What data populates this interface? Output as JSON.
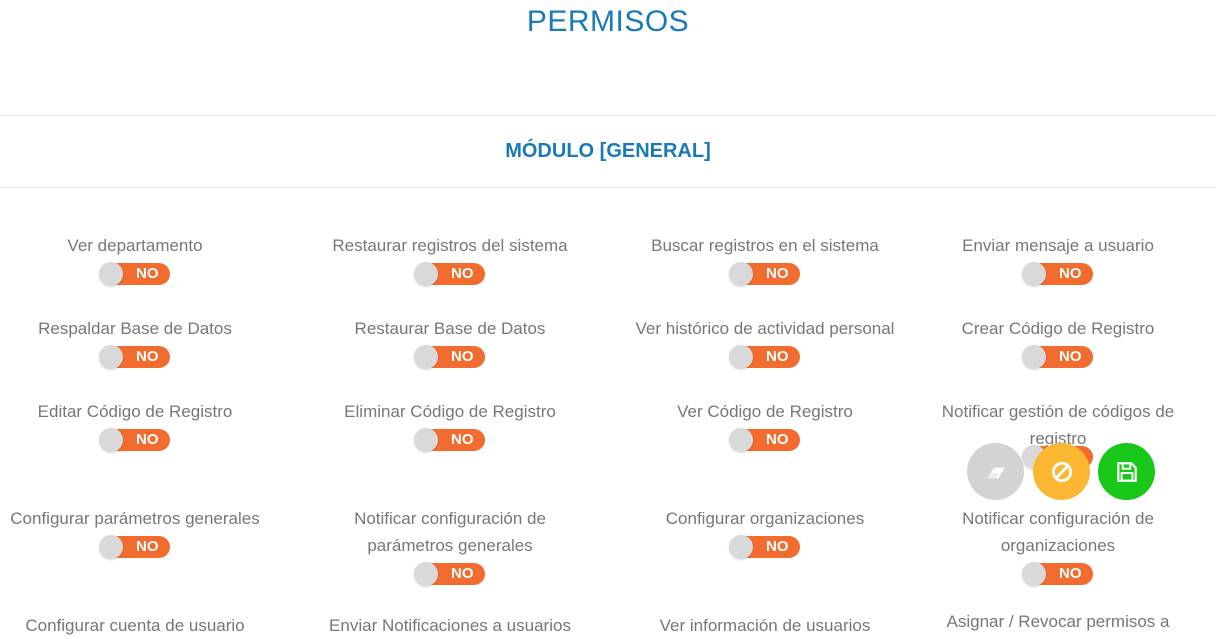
{
  "header": {
    "title": "PERMISOS"
  },
  "module": {
    "title": "MÓDULO [GENERAL]"
  },
  "toggle_state": "NO",
  "colors": {
    "accent": "#1a7ab8",
    "toggle_off": "#f26c2f",
    "clear_button": "#d3d3d3",
    "cancel_button": "#fbb731",
    "save_button": "#19c719"
  },
  "columns": [
    [
      "Ver departamento",
      "Respaldar Base de Datos",
      "Editar Código de Registro",
      "Configurar parámetros generales",
      "Configurar cuenta de usuario"
    ],
    [
      "Restaurar registros del sistema",
      "Restaurar Base de Datos",
      "Eliminar Código de Registro",
      "Notificar configuración de parámetros generales",
      "Enviar Notificaciones a usuarios"
    ],
    [
      "Buscar registros en el sistema",
      "Ver histórico de actividad personal",
      "Ver Código de Registro",
      "Configurar organizaciones",
      "Ver información de usuarios"
    ],
    [
      "Enviar mensaje a usuario",
      "Crear Código de Registro",
      "Notificar gestión de códigos de registro",
      "Notificar configuración de organizaciones",
      "Asignar / Revocar permisos a"
    ]
  ],
  "actions": {
    "clear": {
      "icon": "eraser-icon"
    },
    "cancel": {
      "icon": "ban-icon"
    },
    "save": {
      "icon": "floppy-disk-icon"
    }
  }
}
